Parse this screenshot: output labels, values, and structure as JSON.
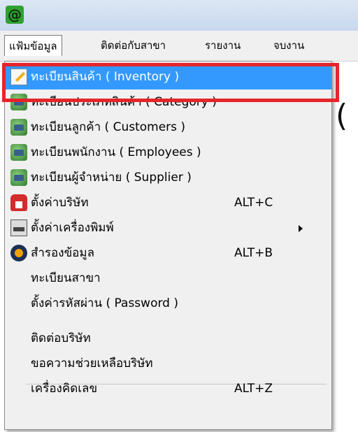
{
  "titlebar": {
    "app_icon_glyph": "@",
    "app_icon_name": "app-at-icon"
  },
  "menubar": {
    "items": [
      {
        "label": "แฟ้มข้อมูล"
      },
      {
        "label": "ติดต่อกับสาขา"
      },
      {
        "label": "รายงาน"
      },
      {
        "label": "จบงาน"
      }
    ]
  },
  "dropdown": {
    "items": [
      {
        "label": "ทะเบียนสินค้า ( Inventory )",
        "icon": "edit-icon",
        "selected": true
      },
      {
        "label": "ทะเบียนประเภทสินค้า ( Category )",
        "icon": "database-icon"
      },
      {
        "label": "ทะเบียนลูกค้า ( Customers )",
        "icon": "database-icon"
      },
      {
        "label": "ทะเบียนพนักงาน ( Employees )",
        "icon": "database-icon"
      },
      {
        "label": "ทะเบียนผู้จำหน่าย ( Supplier )",
        "icon": "database-icon"
      },
      {
        "label": "ตั้งค่าบริษัท",
        "icon": "house-icon",
        "shortcut": "ALT+C"
      },
      {
        "label": "ตั้งค่าเครื่องพิมพ์",
        "icon": "printer-icon",
        "submenu": true
      },
      {
        "label": "สำรองข้อมูล",
        "icon": "backup-icon",
        "shortcut": "ALT+B"
      },
      {
        "label": "ทะเบียนสาขา"
      },
      {
        "label": "ตั้งค่ารหัสผ่าน ( Password )"
      },
      {
        "label": "ติดต่อบริษัท"
      },
      {
        "label": "ขอความช่วยเหลือบริษัท"
      },
      {
        "label": "เครื่องคิดเลข",
        "shortcut": "ALT+Z"
      }
    ]
  },
  "colors": {
    "selection": "#3399ff",
    "highlight_border": "#e5252a"
  }
}
